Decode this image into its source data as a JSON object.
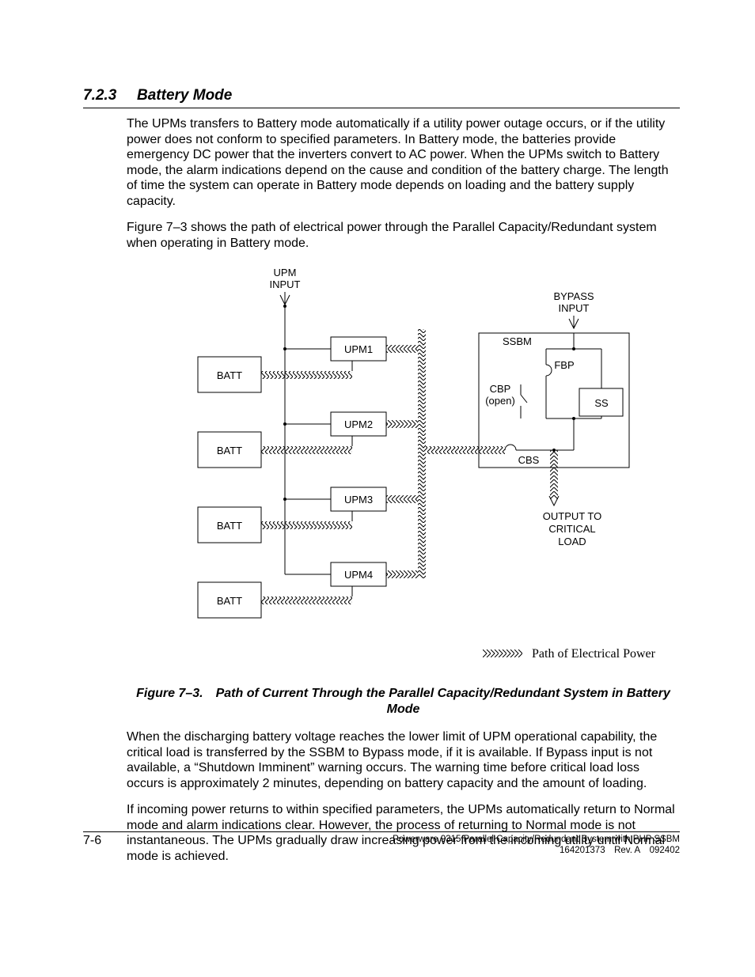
{
  "section": {
    "number": "7.2.3",
    "title": "Battery Mode"
  },
  "paragraphs": {
    "p1": "The UPMs transfers to Battery mode automatically if a utility power outage occurs, or if the utility power does not conform to specified parameters.  In Battery mode, the batteries provide emergency DC power that the inverters convert to AC power.  When the UPMs switch to Battery mode, the alarm indications depend on the cause and condition of the battery charge.  The length of time the system can operate in Battery mode depends on loading and the battery supply capacity.",
    "p2": "Figure 7–3 shows the path of electrical power through the Parallel Capacity/Redundant system when operating in Battery mode.",
    "caption": "Figure 7–3. Path of Current Through the Parallel Capacity/Redundant System in Battery Mode",
    "p3": "When the discharging battery voltage reaches the lower limit of UPM operational capability, the critical load is transferred by the SSBM to Bypass mode, if it is available.  If Bypass input is not available, a “Shutdown Imminent” warning occurs.  The warning time before critical load loss occurs is approximately 2 minutes, depending on battery capacity and the amount of loading.",
    "p4": "If incoming power returns to within specified parameters, the UPMs automatically return to Normal mode and alarm indications clear.  However, the process of returning to Normal mode is not instantaneous.  The UPMs gradually draw increasing power from the incoming utility until Normal mode is achieved."
  },
  "diagram": {
    "upm_input_l1": "UPM",
    "upm_input_l2": "INPUT",
    "bypass_l1": "BYPASS",
    "bypass_l2": "INPUT",
    "batt": "BATT",
    "upm1": "UPM1",
    "upm2": "UPM2",
    "upm3": "UPM3",
    "upm4": "UPM4",
    "ssbm": "SSBM",
    "fbp": "FBP",
    "ss": "SS",
    "cbs": "CBS",
    "cbp_l1": "CBP",
    "cbp_l2": "(open)",
    "out_l1": "OUTPUT TO",
    "out_l2": "CRITICAL",
    "out_l3": "LOAD",
    "legend": "Path of Electrical Power"
  },
  "footer": {
    "page": "7-6",
    "line1": "Powerware 9315 Parallel Capacity/Redundant System with PHP SSBM",
    "line2": "164201373 Rev. A 092402"
  }
}
